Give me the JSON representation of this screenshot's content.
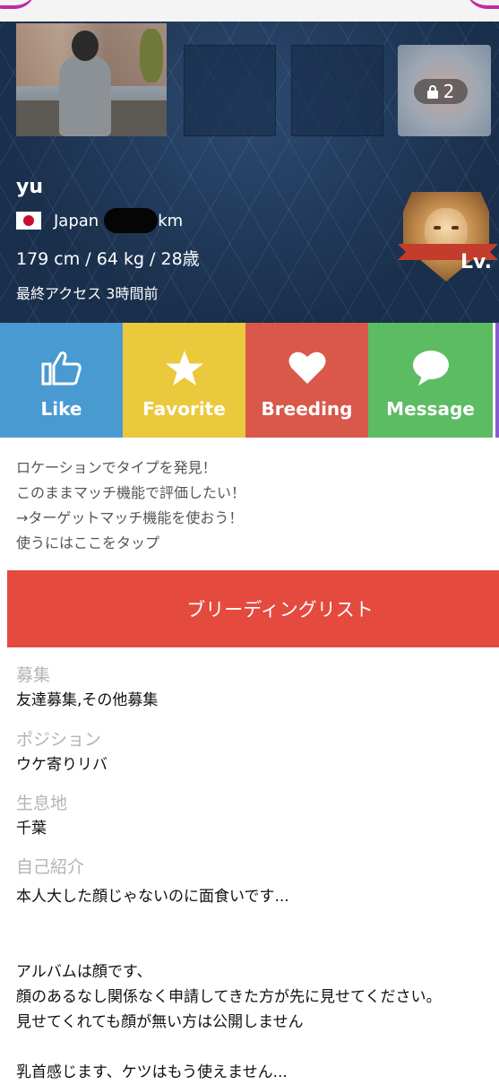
{
  "profile": {
    "photo_lock_count": "2",
    "name": "yu",
    "country": "Japan",
    "distance_unit": "km",
    "stats": "179 cm / 64 kg / 28歳",
    "last_access": "最終アクセス 3時間前",
    "level_label": "Lv."
  },
  "actions": {
    "like": "Like",
    "favorite": "Favorite",
    "breeding": "Breeding",
    "message": "Message"
  },
  "colors": {
    "like": "#4a9ad2",
    "favorite": "#ebc93c",
    "breeding": "#d9584a",
    "message": "#5cbc62",
    "breeding_list_button": "#e54a3f"
  },
  "promo": {
    "line1": "ロケーションでタイプを発見！",
    "line2": "このままマッチ機能で評価したい！",
    "line3": "→ターゲットマッチ機能を使おう！",
    "line4": "使うにはここをタップ"
  },
  "breeding_list_button": "ブリーディングリスト",
  "details": {
    "recruit_label": "募集",
    "recruit_value": "友達募集,その他募集",
    "position_label": "ポジション",
    "position_value": "ウケ寄りリバ",
    "habitat_label": "生息地",
    "habitat_value": "千葉",
    "intro_label": "自己紹介",
    "intro_text": "本人大した顔じゃないのに面食いです...\n\n\nアルバムは顔です、\n顔のあるなし関係なく申請してきた方が先に見せてください。\n見せてくれても顔が無い方は公開しません\n\n乳首感じます、ケツはもう使えません..."
  }
}
